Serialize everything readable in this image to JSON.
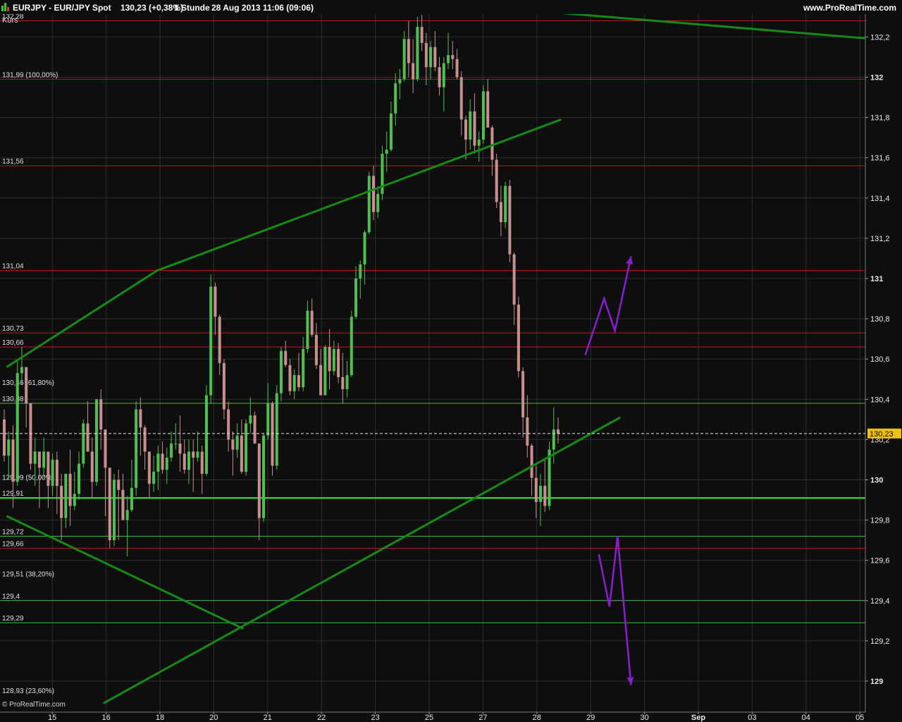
{
  "header": {
    "symbol_line": "EURJPY - EUR/JPY Spot",
    "price_change": "130,23 (+0,38%)",
    "timeframe": "1 Stunde",
    "datetime": "28 Aug 2013 11:06 (09:06)",
    "site": "www.ProRealTime.com",
    "kurs_label": "Kurs",
    "footer_logo": "© ProRealTime.com"
  },
  "colors": {
    "background": "#0e0e0e",
    "grid": "#2e2e2e",
    "red_level": "#c41818",
    "green_level": "#3fbf3f",
    "trendline": "#168a16",
    "candle_up": "#4fc04f",
    "candle_down": "#c88f8f",
    "projection": "#8a1ecf",
    "current_price_tag": "#f2c200"
  },
  "chart_data": {
    "type": "candlestick",
    "symbol": "EURJPY",
    "timeframe": "1 Stunde",
    "current_price": 130.23,
    "current_price_label": "130,23",
    "ylim": [
      128.9,
      132.3
    ],
    "y_ticks": [
      {
        "value": 129,
        "label": "129"
      },
      {
        "value": 129.2,
        "label": "129,2"
      },
      {
        "value": 129.4,
        "label": "129,4"
      },
      {
        "value": 129.6,
        "label": "129,6"
      },
      {
        "value": 129.8,
        "label": "129,8"
      },
      {
        "value": 130,
        "label": "130"
      },
      {
        "value": 130.2,
        "label": "130,2"
      },
      {
        "value": 130.4,
        "label": "130,4"
      },
      {
        "value": 130.6,
        "label": "130,6"
      },
      {
        "value": 130.8,
        "label": "130,8"
      },
      {
        "value": 131,
        "label": "131"
      },
      {
        "value": 131.2,
        "label": "131,2"
      },
      {
        "value": 131.4,
        "label": "131,4"
      },
      {
        "value": 131.6,
        "label": "131,6"
      },
      {
        "value": 131.8,
        "label": "131,8"
      },
      {
        "value": 132,
        "label": "132"
      },
      {
        "value": 132.2,
        "label": "132,2"
      }
    ],
    "x_ticks": [
      {
        "label": "15",
        "t": 0.5
      },
      {
        "label": "16",
        "t": 1.5
      },
      {
        "label": "18",
        "t": 2.5
      },
      {
        "label": "20",
        "t": 3.5
      },
      {
        "label": "21",
        "t": 4.5
      },
      {
        "label": "22",
        "t": 5.5
      },
      {
        "label": "23",
        "t": 6.5
      },
      {
        "label": "25",
        "t": 7.5
      },
      {
        "label": "27",
        "t": 8.5
      },
      {
        "label": "28",
        "t": 9.5
      },
      {
        "label": "29",
        "t": 10.5
      },
      {
        "label": "30",
        "t": 11.5
      },
      {
        "label": "Sep",
        "t": 12.5
      },
      {
        "label": "03",
        "t": 13.5
      },
      {
        "label": "04",
        "t": 14.5
      },
      {
        "label": "05",
        "t": 15.5
      }
    ],
    "horizontal_levels": [
      {
        "value": 132.28,
        "label": "132,28",
        "color": "red",
        "width": 1
      },
      {
        "value": 131.99,
        "label": "131,99 (100,00%)",
        "color": "red",
        "width": 1
      },
      {
        "value": 131.56,
        "label": "131,56",
        "color": "red",
        "width": 1
      },
      {
        "value": 131.04,
        "label": "131,04",
        "color": "red",
        "width": 1
      },
      {
        "value": 130.73,
        "label": "130,73",
        "color": "red",
        "width": 1
      },
      {
        "value": 130.66,
        "label": "130,66",
        "color": "red",
        "width": 1
      },
      {
        "value": 130.46,
        "label": "130,46 (61,80%)",
        "color": "none",
        "width": 0
      },
      {
        "value": 130.38,
        "label": "130,38",
        "color": "green",
        "width": 1
      },
      {
        "value": 129.99,
        "label": "129,99 (50,00%)",
        "color": "none",
        "width": 0
      },
      {
        "value": 129.91,
        "label": "129,91",
        "color": "green",
        "width": 2.5
      },
      {
        "value": 129.72,
        "label": "129,72",
        "color": "green",
        "width": 1
      },
      {
        "value": 129.66,
        "label": "129,66",
        "color": "red",
        "width": 1
      },
      {
        "value": 129.51,
        "label": "129,51 (38,20%)",
        "color": "none",
        "width": 0
      },
      {
        "value": 129.4,
        "label": "129,4",
        "color": "green",
        "width": 1
      },
      {
        "value": 129.29,
        "label": "129,29",
        "color": "green",
        "width": 1
      },
      {
        "value": 128.93,
        "label": "128,93 (23,60%)",
        "color": "none",
        "width": 0
      }
    ],
    "trendlines": [
      {
        "name": "upper-channel",
        "points": [
          [
            -0.35,
            130.56
          ],
          [
            2.45,
            131.04
          ],
          [
            9.95,
            131.79
          ]
        ]
      },
      {
        "name": "lower-channel",
        "points": [
          [
            1.45,
            128.89
          ],
          [
            11.05,
            130.31
          ]
        ]
      },
      {
        "name": "descending",
        "points": [
          [
            -0.35,
            129.82
          ],
          [
            4.05,
            129.26
          ]
        ]
      },
      {
        "name": "top-resistance",
        "points": [
          [
            9.9,
            132.32
          ],
          [
            16.2,
            132.18
          ]
        ]
      }
    ],
    "projections": [
      {
        "name": "bullish-scenario",
        "points": [
          [
            10.4,
            130.62
          ],
          [
            10.75,
            130.9
          ],
          [
            10.95,
            130.74
          ],
          [
            11.25,
            131.11
          ]
        ]
      },
      {
        "name": "bearish-scenario",
        "points": [
          [
            10.65,
            129.63
          ],
          [
            10.85,
            129.37
          ],
          [
            11.0,
            129.72
          ],
          [
            11.25,
            128.98
          ]
        ]
      }
    ],
    "candles_ohlc": [
      [
        130.3,
        130.35,
        130.09,
        130.12
      ],
      [
        130.12,
        130.24,
        130.0,
        130.2
      ],
      [
        130.2,
        130.27,
        129.86,
        129.99
      ],
      [
        129.99,
        130.6,
        129.97,
        130.53
      ],
      [
        130.53,
        130.66,
        130.47,
        130.56
      ],
      [
        130.56,
        130.56,
        130.26,
        130.38
      ],
      [
        130.38,
        130.38,
        130.05,
        130.08
      ],
      [
        130.08,
        130.21,
        129.97,
        130.14
      ],
      [
        130.14,
        130.14,
        129.86,
        130.06
      ],
      [
        130.06,
        130.21,
        130.01,
        130.14
      ],
      [
        130.14,
        130.14,
        129.86,
        129.97
      ],
      [
        129.97,
        130.13,
        129.92,
        130.1
      ],
      [
        130.1,
        130.14,
        129.83,
        129.97
      ],
      [
        129.97,
        130.03,
        129.7,
        129.81
      ],
      [
        129.81,
        130.01,
        129.76,
        130.03
      ],
      [
        130.03,
        130.15,
        129.77,
        129.87
      ],
      [
        129.87,
        130.04,
        129.85,
        129.93
      ],
      [
        129.93,
        130.14,
        129.9,
        130.08
      ],
      [
        130.08,
        130.3,
        130.06,
        130.28
      ],
      [
        130.28,
        130.39,
        130.14,
        130.14
      ],
      [
        130.14,
        130.21,
        129.91,
        129.99
      ],
      [
        129.99,
        130.4,
        129.97,
        130.4
      ],
      [
        130.4,
        130.45,
        130.15,
        130.25
      ],
      [
        130.25,
        130.25,
        129.82,
        130.06
      ],
      [
        130.06,
        130.06,
        129.66,
        129.7
      ],
      [
        129.7,
        130.03,
        129.67,
        130.0
      ],
      [
        130.0,
        130.05,
        129.7,
        129.95
      ],
      [
        129.95,
        130.03,
        129.8,
        129.8
      ],
      [
        129.8,
        129.92,
        129.62,
        129.85
      ],
      [
        129.85,
        130.1,
        129.84,
        129.96
      ],
      [
        129.96,
        130.39,
        129.92,
        130.35
      ],
      [
        130.35,
        130.41,
        130.12,
        130.26
      ],
      [
        130.26,
        130.27,
        130.05,
        130.14
      ],
      [
        130.14,
        130.14,
        129.91,
        129.98
      ],
      [
        129.98,
        130.12,
        129.94,
        130.04
      ],
      [
        130.04,
        130.17,
        129.95,
        130.13
      ],
      [
        130.13,
        130.19,
        130.03,
        130.05
      ],
      [
        130.05,
        130.16,
        129.98,
        130.11
      ],
      [
        130.11,
        130.24,
        130.09,
        130.18
      ],
      [
        130.18,
        130.28,
        130.15,
        130.18
      ],
      [
        130.18,
        130.32,
        130.04,
        130.13
      ],
      [
        130.13,
        130.2,
        130.03,
        130.05
      ],
      [
        130.05,
        130.2,
        129.98,
        130.14
      ],
      [
        130.14,
        130.2,
        129.94,
        130.11
      ],
      [
        130.11,
        130.24,
        130.09,
        130.14
      ],
      [
        130.14,
        130.17,
        129.93,
        130.03
      ],
      [
        130.03,
        130.47,
        130.02,
        130.42
      ],
      [
        130.42,
        131.02,
        130.38,
        130.96
      ],
      [
        130.96,
        130.98,
        130.72,
        130.81
      ],
      [
        130.81,
        130.82,
        130.52,
        130.58
      ],
      [
        130.58,
        130.6,
        130.3,
        130.35
      ],
      [
        130.35,
        130.39,
        130.14,
        130.2
      ],
      [
        130.2,
        130.24,
        130.02,
        130.15
      ],
      [
        130.15,
        130.28,
        130.11,
        130.22
      ],
      [
        130.22,
        130.3,
        130.03,
        130.04
      ],
      [
        130.04,
        130.3,
        130.02,
        130.28
      ],
      [
        130.28,
        130.41,
        130.23,
        130.32
      ],
      [
        130.32,
        130.34,
        130.18,
        130.18
      ],
      [
        130.18,
        130.18,
        129.7,
        129.81
      ],
      [
        129.81,
        130.23,
        129.79,
        130.22
      ],
      [
        130.22,
        130.48,
        130.2,
        130.38
      ],
      [
        130.38,
        130.39,
        130.02,
        130.07
      ],
      [
        130.07,
        130.47,
        130.05,
        130.43
      ],
      [
        130.43,
        130.66,
        130.39,
        130.64
      ],
      [
        130.64,
        130.69,
        130.56,
        130.57
      ],
      [
        130.57,
        130.6,
        130.42,
        130.44
      ],
      [
        130.44,
        130.55,
        130.4,
        130.52
      ],
      [
        130.52,
        130.63,
        130.44,
        130.46
      ],
      [
        130.46,
        130.71,
        130.44,
        130.65
      ],
      [
        130.65,
        130.89,
        130.63,
        130.84
      ],
      [
        130.84,
        130.9,
        130.71,
        130.72
      ],
      [
        130.72,
        130.78,
        130.55,
        130.57
      ],
      [
        130.57,
        130.65,
        130.42,
        130.42
      ],
      [
        130.42,
        130.67,
        130.42,
        130.66
      ],
      [
        130.66,
        130.75,
        130.45,
        130.54
      ],
      [
        130.54,
        130.69,
        130.52,
        130.65
      ],
      [
        130.65,
        130.68,
        130.48,
        130.51
      ],
      [
        130.51,
        130.63,
        130.38,
        130.45
      ],
      [
        130.45,
        130.59,
        130.41,
        130.52
      ],
      [
        130.52,
        130.84,
        130.51,
        130.81
      ],
      [
        130.81,
        131.06,
        130.8,
        131.0
      ],
      [
        131.0,
        131.09,
        130.9,
        131.07
      ],
      [
        131.07,
        131.24,
        130.97,
        131.23
      ],
      [
        131.23,
        131.53,
        131.22,
        131.51
      ],
      [
        131.51,
        131.56,
        131.29,
        131.33
      ],
      [
        131.33,
        131.46,
        131.3,
        131.42
      ],
      [
        131.42,
        131.66,
        131.39,
        131.62
      ],
      [
        131.62,
        131.73,
        131.53,
        131.64
      ],
      [
        131.64,
        131.88,
        131.63,
        131.82
      ],
      [
        131.82,
        132.02,
        131.76,
        131.97
      ],
      [
        131.97,
        132.04,
        131.89,
        131.99
      ],
      [
        131.99,
        132.23,
        131.98,
        132.19
      ],
      [
        132.19,
        132.28,
        132.0,
        132.07
      ],
      [
        132.07,
        132.19,
        131.92,
        131.99
      ],
      [
        131.99,
        132.3,
        131.98,
        132.25
      ],
      [
        132.25,
        132.31,
        132.13,
        132.17
      ],
      [
        132.17,
        132.22,
        131.96,
        132.05
      ],
      [
        132.05,
        132.18,
        131.99,
        132.15
      ],
      [
        132.15,
        132.23,
        132.03,
        132.05
      ],
      [
        132.05,
        132.1,
        131.91,
        131.95
      ],
      [
        131.95,
        132.1,
        131.83,
        132.07
      ],
      [
        132.07,
        132.22,
        132.04,
        132.11
      ],
      [
        132.11,
        132.18,
        132.04,
        132.09
      ],
      [
        132.09,
        132.14,
        131.99,
        132.0
      ],
      [
        132.0,
        132.03,
        131.71,
        131.79
      ],
      [
        131.79,
        131.81,
        131.59,
        131.69
      ],
      [
        131.69,
        131.89,
        131.64,
        131.83
      ],
      [
        131.83,
        131.92,
        131.62,
        131.66
      ],
      [
        131.66,
        131.73,
        131.58,
        131.69
      ],
      [
        131.69,
        131.96,
        131.67,
        131.93
      ],
      [
        131.93,
        131.99,
        131.75,
        131.75
      ],
      [
        131.75,
        131.76,
        131.51,
        131.59
      ],
      [
        131.59,
        131.62,
        131.35,
        131.38
      ],
      [
        131.38,
        131.46,
        131.21,
        131.28
      ],
      [
        131.28,
        131.48,
        131.25,
        131.46
      ],
      [
        131.46,
        131.49,
        131.08,
        131.12
      ],
      [
        131.12,
        131.13,
        130.77,
        130.87
      ],
      [
        130.87,
        130.91,
        130.51,
        130.54
      ],
      [
        130.54,
        130.56,
        130.21,
        130.31
      ],
      [
        130.31,
        130.42,
        130.11,
        130.17
      ],
      [
        130.17,
        130.18,
        129.92,
        130.01
      ],
      [
        130.01,
        130.07,
        129.81,
        129.89
      ],
      [
        129.89,
        130.03,
        129.77,
        129.97
      ],
      [
        129.97,
        130.11,
        129.84,
        129.87
      ],
      [
        129.87,
        130.19,
        129.85,
        130.15
      ],
      [
        130.15,
        130.36,
        130.08,
        130.25
      ],
      [
        130.25,
        130.31,
        130.18,
        130.23
      ]
    ]
  }
}
